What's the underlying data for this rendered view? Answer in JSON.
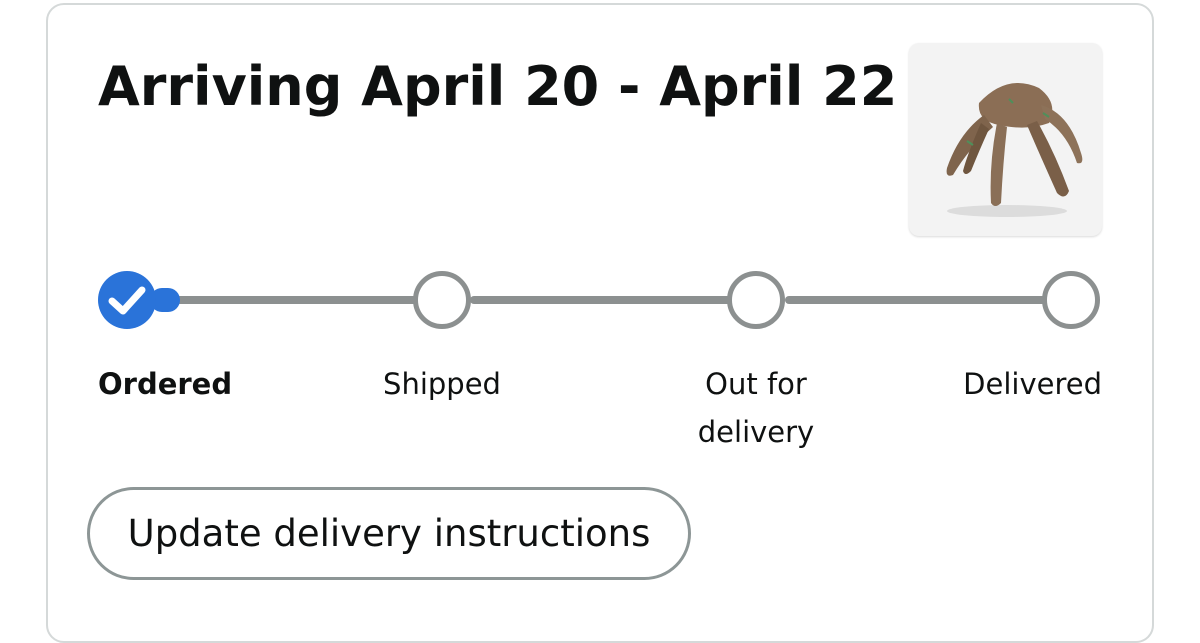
{
  "shipment": {
    "heading": "Arriving April 20 - April 22"
  },
  "product": {
    "image_icon": "product-thumbnail"
  },
  "tracker": {
    "accent_color": "#2a73d9",
    "pending_color": "#8c9090",
    "current_step": 1,
    "steps": [
      {
        "label": "Ordered",
        "status": "complete",
        "icon": "checkmark-icon"
      },
      {
        "label": "Shipped",
        "status": "pending"
      },
      {
        "label": "Out for delivery",
        "status": "pending"
      },
      {
        "label": "Delivered",
        "status": "pending"
      }
    ]
  },
  "actions": {
    "update_instructions_label": "Update delivery instructions"
  }
}
